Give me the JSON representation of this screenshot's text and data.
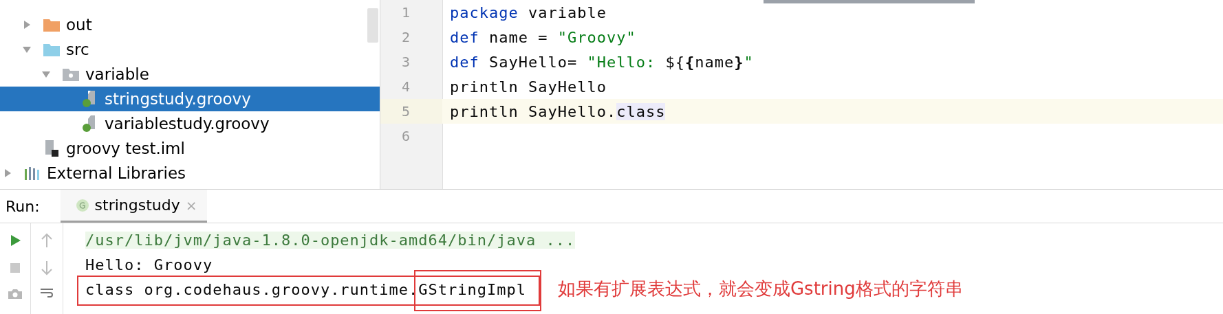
{
  "project_tree": {
    "items": [
      {
        "label": "out",
        "kind": "output-folder",
        "expanded": false,
        "selected": false
      },
      {
        "label": "src",
        "kind": "source-folder",
        "expanded": true,
        "selected": false,
        "children": [
          {
            "label": "variable",
            "kind": "package",
            "expanded": true,
            "selected": false,
            "children": [
              {
                "label": "stringstudy.groovy",
                "kind": "groovy-file",
                "selected": true
              },
              {
                "label": "variablestudy.groovy",
                "kind": "groovy-file",
                "selected": false
              }
            ]
          }
        ]
      },
      {
        "label": "groovy test.iml",
        "kind": "module-file",
        "selected": false
      },
      {
        "label": "External Libraries",
        "kind": "library",
        "expanded": false,
        "selected": false
      }
    ]
  },
  "editor": {
    "lines": [
      {
        "number": "1",
        "current": false,
        "tokens": [
          {
            "text": "package",
            "kind": "keyword"
          },
          {
            "text": " variable",
            "kind": "plain"
          }
        ]
      },
      {
        "number": "2",
        "current": false,
        "tokens": [
          {
            "text": "def",
            "kind": "keyword"
          },
          {
            "text": " name = ",
            "kind": "plain"
          },
          {
            "text": "\"Groovy\"",
            "kind": "string"
          }
        ]
      },
      {
        "number": "3",
        "current": false,
        "tokens": [
          {
            "text": "def",
            "kind": "keyword"
          },
          {
            "text": " SayHello= ",
            "kind": "plain"
          },
          {
            "text": "\"Hello: ",
            "kind": "string"
          },
          {
            "text": "${",
            "kind": "plain"
          },
          {
            "text": "{",
            "kind": "brace"
          },
          {
            "text": "name",
            "kind": "plain"
          },
          {
            "text": "}",
            "kind": "brace"
          },
          {
            "text": "\"",
            "kind": "string"
          }
        ]
      },
      {
        "number": "4",
        "current": false,
        "tokens": [
          {
            "text": "println SayHello",
            "kind": "plain"
          }
        ]
      },
      {
        "number": "5",
        "current": true,
        "tokens": [
          {
            "text": "println SayHello.",
            "kind": "plain"
          },
          {
            "text": "class",
            "kind": "highlight"
          }
        ]
      },
      {
        "number": "6",
        "current": false
      }
    ]
  },
  "run_panel": {
    "label": "Run:",
    "tabs": [
      {
        "label": "stringstudy",
        "close": "×",
        "selected": true
      }
    ],
    "console_lines": [
      {
        "text": "/usr/lib/jvm/java-1.8.0-openjdk-amd64/bin/java ...",
        "kind": "command"
      },
      {
        "text": "Hello: Groovy",
        "kind": "output"
      },
      {
        "text": "class org.codehaus.groovy.runtime.GStringImpl",
        "kind": "output",
        "boxed": true
      }
    ],
    "annotation": "如果有扩展表达式，就会变成Gstring格式的字符串"
  }
}
